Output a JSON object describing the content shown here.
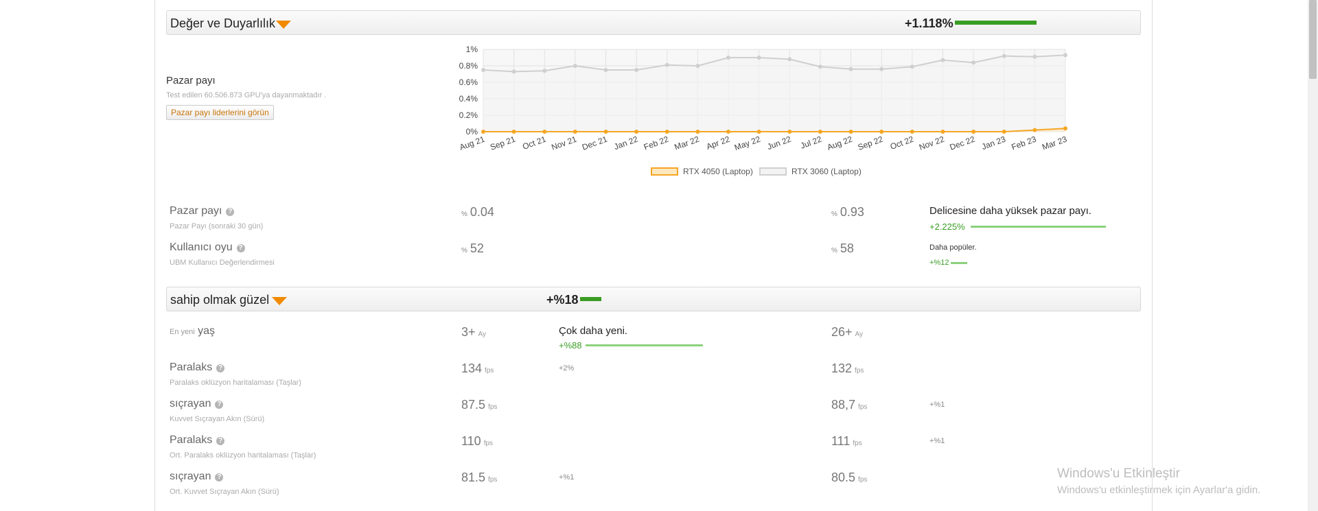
{
  "section1": {
    "title": "Değer ve Duyarlılık",
    "pct": "+1.118%",
    "accent": "#3a9d23",
    "caret_color": "#f18a00"
  },
  "market_share": {
    "title": "Pazar payı",
    "subtitle": "Test edilen 60.506.873 GPU'ya dayanmaktadır .",
    "button": "Pazar payı liderlerini görün"
  },
  "chart_data": {
    "type": "line",
    "categories": [
      "Aug 21",
      "Sep 21",
      "Oct 21",
      "Nov 21",
      "Dec 21",
      "Jan 22",
      "Feb 22",
      "Mar 22",
      "Apr 22",
      "May 22",
      "Jun 22",
      "Jul 22",
      "Aug 22",
      "Sep 22",
      "Oct 22",
      "Nov 22",
      "Dec 22",
      "Jan 23",
      "Feb 23",
      "Mar 23"
    ],
    "y_ticks": [
      "0%",
      "0.2%",
      "0.4%",
      "0.6%",
      "0.8%",
      "1%"
    ],
    "ylim": [
      0,
      1
    ],
    "grid": true,
    "legend_position": "bottom",
    "series": [
      {
        "name": "RTX 4050 (Laptop)",
        "color": "#f5a623",
        "fill": "#fde8c0",
        "values": [
          0,
          0,
          0,
          0,
          0,
          0,
          0,
          0,
          0,
          0,
          0,
          0,
          0,
          0,
          0,
          0,
          0,
          0,
          0.02,
          0.04
        ]
      },
      {
        "name": "RTX 3060 (Laptop)",
        "color": "#cfcfcf",
        "fill": "#f3f3f3",
        "values": [
          0.75,
          0.73,
          0.74,
          0.8,
          0.75,
          0.75,
          0.81,
          0.8,
          0.9,
          0.9,
          0.88,
          0.79,
          0.76,
          0.76,
          0.79,
          0.87,
          0.84,
          0.92,
          0.91,
          0.93
        ]
      }
    ]
  },
  "rows1": [
    {
      "label": "Pazar payı",
      "help": "?",
      "sub": "Pazar Payı (sonraki 30 gün)",
      "a_prefix": "%",
      "a_value": "0.04",
      "b_prefix": "%",
      "b_value": "0.93",
      "cmp_title": "Delicesine daha yüksek pazar payı.",
      "cmp_pct": "+2.225%"
    },
    {
      "label": "Kullanıcı oyu",
      "help": "?",
      "sub": "UBM Kullanıcı Değerlendirmesi",
      "a_prefix": "%",
      "a_value": "52",
      "b_prefix": "%",
      "b_value": "58",
      "cmp_title": "Daha popüler.",
      "cmp_pct": "+%12"
    }
  ],
  "section2": {
    "title": "sahip olmak güzel",
    "pct": "+%18"
  },
  "age_row": {
    "label_small": "En yeni",
    "label": "yaş",
    "a_value": "3+",
    "a_unit": "Ay",
    "b_value": "26+",
    "b_unit": "Ay",
    "cmp_title": "Çok daha yeni.",
    "cmp_pct": "+%88"
  },
  "fps_rows": [
    {
      "label": "Paralaks",
      "help": "?",
      "sub": "Paralaks oklüzyon haritalaması (Taşlar)",
      "a_value": "134",
      "a_unit": "fps",
      "a_delta": "+2%",
      "b_value": "132",
      "b_unit": "fps",
      "b_delta": ""
    },
    {
      "label": "sıçrayan",
      "help": "?",
      "sub": "Kuvvet Sıçrayan Akın (Sürü)",
      "a_value": "87.5",
      "a_unit": "fps",
      "a_delta": "",
      "b_value": "88,7",
      "b_unit": "fps",
      "b_delta": "+%1"
    },
    {
      "label": "Paralaks",
      "help": "?",
      "sub": "Ort. Paralaks oklüzyon haritalaması (Taşlar)",
      "a_value": "110",
      "a_unit": "fps",
      "a_delta": "",
      "b_value": "111",
      "b_unit": "fps",
      "b_delta": "+%1"
    },
    {
      "label": "sıçrayan",
      "help": "?",
      "sub": "Ort. Kuvvet Sıçrayan Akın (Sürü)",
      "a_value": "81.5",
      "a_unit": "fps",
      "a_delta": "+%1",
      "b_value": "80.5",
      "b_unit": "fps",
      "b_delta": ""
    }
  ],
  "watermark": {
    "title": "Windows'u Etkinleştir",
    "text": "Windows'u etkinleştirmek için Ayarlar'a gidin."
  }
}
